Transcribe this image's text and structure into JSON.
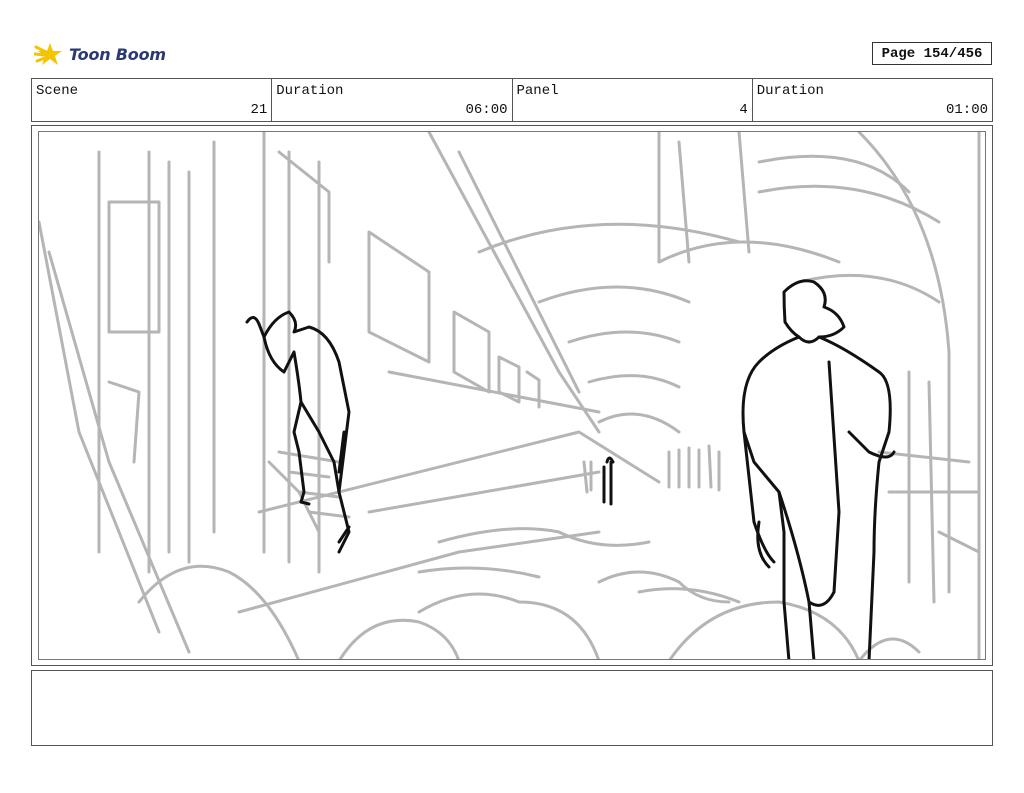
{
  "header": {
    "logo_text": "Toon Boom",
    "page_label": "Page 154/456"
  },
  "info": {
    "scene_label": "Scene",
    "scene_value": "21",
    "scene_duration_label": "Duration",
    "scene_duration_value": "06:00",
    "panel_label": "Panel",
    "panel_value": "4",
    "panel_duration_label": "Duration",
    "panel_duration_value": "01:00"
  },
  "panel": {
    "image": "storyboard-sketch",
    "description_colors": {
      "sketch_grey": "#b0b0b0",
      "ink_black": "#111111"
    }
  },
  "notes": {
    "text": ""
  },
  "colors": {
    "logo_star": "#f5c400",
    "logo_text": "#2a3a73",
    "border": "#555555"
  }
}
